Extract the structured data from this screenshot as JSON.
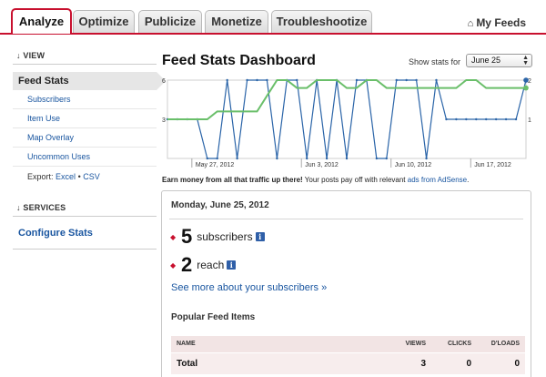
{
  "tabs": [
    {
      "label": "Analyze",
      "active": true
    },
    {
      "label": "Optimize",
      "active": false
    },
    {
      "label": "Publicize",
      "active": false
    },
    {
      "label": "Monetize",
      "active": false
    },
    {
      "label": "Troubleshootize",
      "active": false
    }
  ],
  "header": {
    "my_feeds": "My Feeds",
    "house_icon": "⌂"
  },
  "sidebar": {
    "view_heading": "↓ VIEW",
    "active_item": "Feed Stats",
    "items": [
      "Subscribers",
      "Item Use",
      "Map Overlay",
      "Uncommon Uses"
    ],
    "export_label": "Export:",
    "export_excel": "Excel",
    "export_sep": "•",
    "export_csv": "CSV",
    "services_heading": "↓ SERVICES",
    "configure_stats": "Configure Stats"
  },
  "main": {
    "title": "Feed Stats Dashboard",
    "show_stats_for": "Show stats for",
    "date_select": "June 25",
    "ad_bold": "Earn money from all that traffic up there!",
    "ad_text": " Your posts pay off with relevant ",
    "ad_link": "ads from AdSense",
    "ad_end": ".",
    "panel": {
      "date": "Monday, June 25, 2012",
      "subscribers_value": "5",
      "subscribers_label": "subscribers",
      "reach_value": "2",
      "reach_label": "reach",
      "info_icon": "i",
      "see_more": "See more about your subscribers »",
      "popular_heading": "Popular Feed Items",
      "table_headers": [
        "NAME",
        "VIEWS",
        "CLICKS",
        "D'LOADS"
      ],
      "table_rows": [
        [
          "Total",
          "3",
          "0",
          "0"
        ]
      ]
    }
  },
  "chart_data": {
    "type": "line",
    "x_labels": [
      "May 27, 2012",
      "Jun 3, 2012",
      "Jun 10, 2012",
      "Jun 17, 2012"
    ],
    "y_left_ticks": [
      "6",
      "3"
    ],
    "y_right_ticks": [
      "2",
      "1"
    ],
    "ylim_left": [
      0,
      6
    ],
    "ylim_right": [
      0,
      2
    ],
    "series": [
      {
        "color": "#2a64a8",
        "axis": "left",
        "values": [
          3,
          3,
          3,
          3,
          0,
          0,
          6,
          0,
          6,
          6,
          6,
          0,
          6,
          6,
          0,
          6,
          0,
          6,
          0,
          6,
          6,
          0,
          0,
          6,
          6,
          6,
          0,
          6,
          3,
          3,
          3,
          3,
          3,
          3,
          3,
          3,
          6
        ]
      },
      {
        "color": "#6abf6a",
        "axis": "right",
        "values": [
          1,
          1,
          1,
          1,
          1,
          1.2,
          1.2,
          1.2,
          1.2,
          1.2,
          1.6,
          2,
          2,
          1.8,
          1.8,
          2,
          2,
          2,
          1.8,
          1.8,
          2,
          2,
          1.8,
          1.8,
          1.8,
          1.8,
          1.8,
          1.8,
          1.8,
          1.8,
          2,
          2,
          1.8,
          1.8,
          1.8,
          1.8,
          1.8
        ]
      }
    ]
  },
  "colors": {
    "accent": "#c8102e",
    "link": "#1a56a0"
  }
}
